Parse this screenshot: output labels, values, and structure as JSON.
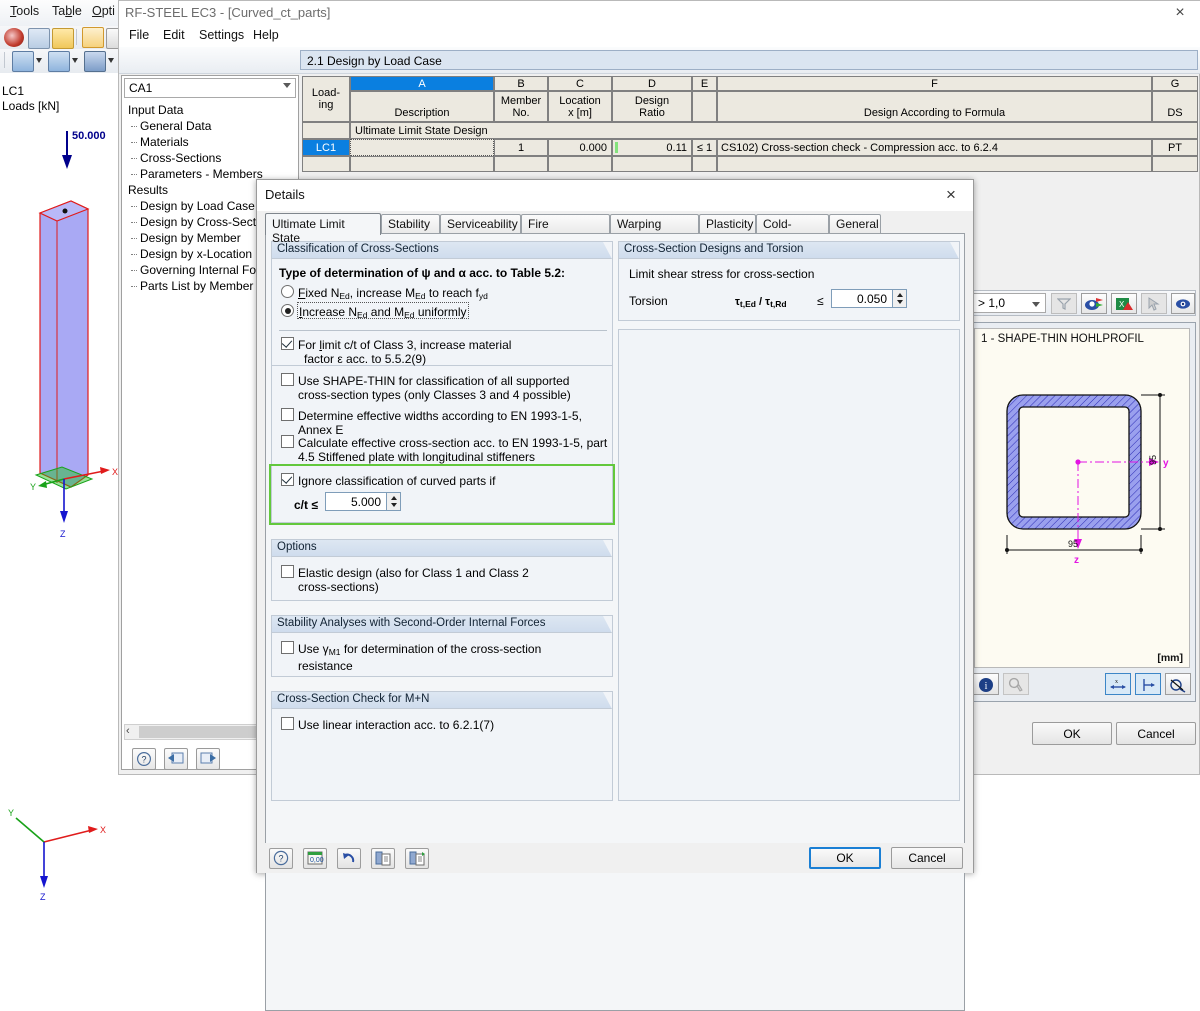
{
  "rfem": {
    "menus": [
      "Tools",
      "Table",
      "Opti"
    ],
    "model": {
      "load_case": "LC1",
      "legend": "Loads [kN]",
      "load_value": "50.000",
      "axes": [
        "X",
        "Y",
        "Z"
      ]
    }
  },
  "app": {
    "title": "RF-STEEL EC3 - [Curved_ct_parts]",
    "close_icon": "×",
    "menus": [
      "File",
      "Edit",
      "Settings",
      "Help"
    ],
    "combo_value": "CA1",
    "tree": [
      {
        "label": "Input Data",
        "level": 0,
        "selected": false
      },
      {
        "label": "General Data",
        "level": 1,
        "selected": false
      },
      {
        "label": "Materials",
        "level": 1,
        "selected": false
      },
      {
        "label": "Cross-Sections",
        "level": 1,
        "selected": false
      },
      {
        "label": "Parameters - Members",
        "level": 1,
        "selected": false
      },
      {
        "label": "Results",
        "level": 0,
        "selected": false
      },
      {
        "label": "Design by Load Case",
        "level": 1,
        "selected": true
      },
      {
        "label": "Design by Cross-Section",
        "level": 1,
        "selected": false
      },
      {
        "label": "Design by Member",
        "level": 1,
        "selected": false
      },
      {
        "label": "Design by x-Location",
        "level": 1,
        "selected": false
      },
      {
        "label": "Governing Internal Forces",
        "level": 1,
        "selected": false
      },
      {
        "label": "Parts List by Member",
        "level": 1,
        "selected": false
      }
    ],
    "table": {
      "title": "2.1 Design by Load Case",
      "col_letters": [
        "",
        "A",
        "B",
        "C",
        "D",
        "E",
        "F",
        "G"
      ],
      "headers_line1": [
        "Load-",
        "",
        "Member",
        "Location",
        "Design",
        "",
        "",
        ""
      ],
      "headers_line2": [
        "ing",
        "Description",
        "No.",
        "x [m]",
        "Ratio",
        "",
        "Design According to Formula",
        "DS"
      ],
      "group_row": "Ultimate Limit State Design",
      "row": {
        "loading": "LC1",
        "description": "",
        "member_no": "1",
        "location": "0.000",
        "ratio": "0.11",
        "limit": "≤ 1",
        "formula": "CS102) Cross-section check - Compression acc. to 6.2.4",
        "ds": "PT"
      }
    },
    "results_bar": {
      "filter_value": "> 1,0",
      "icons": [
        "funnel-icon",
        "visibility-icon",
        "excel-export-icon",
        "pointer-icon",
        "eye-icon"
      ]
    },
    "cross_section": {
      "name": "1 - SHAPE-THIN HOHLPROFIL",
      "unit": "[mm]",
      "dim_width": "95",
      "dim_height": "95",
      "axis_y": "y",
      "axis_z": "z",
      "tool_icons": [
        "info-icon",
        "color-icon",
        "dim-x-icon",
        "dim-y-icon",
        "no-dim-icon"
      ]
    },
    "ok_label": "OK",
    "cancel_label": "Cancel"
  },
  "dialog": {
    "title": "Details",
    "close_icon": "×",
    "tabs": [
      {
        "label": "Ultimate Limit State",
        "active": true
      },
      {
        "label": "Stability",
        "active": false
      },
      {
        "label": "Serviceability",
        "active": false
      },
      {
        "label": "Fire Resistance",
        "active": false
      },
      {
        "label": "Warping Torsion",
        "active": false
      },
      {
        "label": "Plasticity",
        "active": false
      },
      {
        "label": "Cold-Formed",
        "active": false
      },
      {
        "label": "General",
        "active": false
      }
    ],
    "classification": {
      "group_title": "Classification of Cross-Sections",
      "intro": "Type of determination of ψ and α acc. to Table 5.2:",
      "radio1": "Fixed N Ed, increase M Ed to reach f yd",
      "radio2": "Increase N Ed and M Ed uniformly",
      "radio_selected": 2,
      "chk1_line1": "For limit c/t of Class 3, increase material",
      "chk1_line2": "factor ε acc. to 5.5.2(9)",
      "chk1_checked": true,
      "chk2_line1": "Use SHAPE-THIN for classification of all supported",
      "chk2_line2": "cross-section types (only Classes 3 and 4 possible)",
      "chk2_checked": false,
      "chk3_line1": "Determine effective widths according to EN 1993-1-5, Annex E",
      "chk3_checked": false,
      "chk4_line1": "Calculate effective cross-section acc. to EN 1993-1-5, part",
      "chk4_line2": "4.5 Stiffened plate with longitudinal stiffeners",
      "chk4_checked": false,
      "chk5_label": "Ignore classification of curved parts if",
      "chk5_checked": true,
      "ct_label": "c/t ≤",
      "ct_value": "5.000",
      "highlight_color": "#63c83c"
    },
    "options": {
      "group_title": "Options",
      "chk_line1": "Elastic design (also for Class 1 and Class 2",
      "chk_line2": "cross-sections)",
      "checked": false
    },
    "stability": {
      "group_title": "Stability Analyses with Second-Order Internal Forces",
      "chk_line1": "Use γM1 for determination of the cross-section",
      "chk_line2": "resistance",
      "checked": false
    },
    "mn_check": {
      "group_title": "Cross-Section Check for M+N",
      "chk_line1": "Use linear interaction acc. to 6.2.1(7)",
      "checked": false
    },
    "torsion": {
      "group_title": "Cross-Section Designs and Torsion",
      "subtitle": "Limit shear stress for cross-section",
      "row_label": "Torsion",
      "formula": "τt,Ed / τt,Rd",
      "operator": "≤",
      "value": "0.050"
    },
    "footer": {
      "icons": [
        "help-icon",
        "default-values-icon",
        "undo-icon",
        "copy-icon",
        "paste-icon"
      ],
      "ok_label": "OK",
      "cancel_label": "Cancel"
    }
  }
}
